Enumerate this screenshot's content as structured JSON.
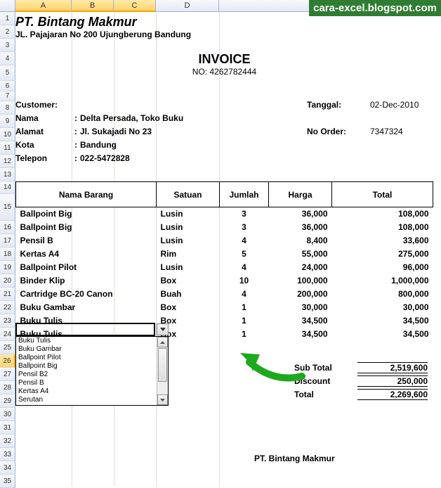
{
  "watermark": "cara-excel.blogspot.com",
  "columns": [
    "A",
    "B",
    "C",
    "D"
  ],
  "row_count": 35,
  "company": {
    "name": "PT. Bintang Makmur",
    "address": "JL. Pajajaran No 200 Ujungberung Bandung"
  },
  "invoice": {
    "title": "INVOICE",
    "number_label": "NO:",
    "number": "4262782444"
  },
  "customer": {
    "header": "Customer:",
    "rows": [
      {
        "label": "Nama",
        "value": "Delta Persada, Toko Buku"
      },
      {
        "label": "Alamat",
        "value": "Jl. Sukajadi No 23"
      },
      {
        "label": "Kota",
        "value": "Bandung"
      },
      {
        "label": "Telepon",
        "value": "022-5472828"
      }
    ],
    "date_label": "Tanggal:",
    "date": "02-Dec-2010",
    "order_label": "No Order:",
    "order": "7347324"
  },
  "table": {
    "headers": [
      "Nama Barang",
      "Satuan",
      "Jumlah",
      "Harga",
      "Total"
    ],
    "rows": [
      {
        "name": "Ballpoint Big",
        "unit": "Lusin",
        "qty": "3",
        "price": "36,000",
        "total": "108,000"
      },
      {
        "name": "Ballpoint Big",
        "unit": "Lusin",
        "qty": "3",
        "price": "36,000",
        "total": "108,000"
      },
      {
        "name": "Pensil B",
        "unit": "Lusin",
        "qty": "4",
        "price": "8,400",
        "total": "33,600"
      },
      {
        "name": "Kertas A4",
        "unit": "Rim",
        "qty": "5",
        "price": "55,000",
        "total": "275,000"
      },
      {
        "name": "Ballpoint Pilot",
        "unit": "Lusin",
        "qty": "4",
        "price": "24,000",
        "total": "96,000"
      },
      {
        "name": "Binder Klip",
        "unit": "Box",
        "qty": "10",
        "price": "100,000",
        "total": "1,000,000"
      },
      {
        "name": "Cartridge BC-20 Canon",
        "unit": "Buah",
        "qty": "4",
        "price": "200,000",
        "total": "800,000"
      },
      {
        "name": "Buku Gambar",
        "unit": "Box",
        "qty": "1",
        "price": "30,000",
        "total": "30,000"
      },
      {
        "name": "Buku Tulis",
        "unit": "Box",
        "qty": "1",
        "price": "34,500",
        "total": "34,500"
      },
      {
        "name": "Buku Tulis",
        "unit": "Box",
        "qty": "1",
        "price": "34,500",
        "total": "34,500"
      }
    ]
  },
  "dropdown": {
    "items": [
      "Buku Tulis",
      "Buku Gambar",
      "Ballpoint Pilot",
      "Ballpoint Big",
      "Pensil B2",
      "Pensil B",
      "Kertas A4",
      "Serutan"
    ]
  },
  "totals": {
    "subtotal_label": "Sub Total",
    "subtotal": "2,519,600",
    "discount_label": "Discount",
    "discount": "250,000",
    "total_label": "Total",
    "total": "2,269,600"
  },
  "footer_company": "PT. Bintang Makmur",
  "active_row": 26,
  "chart_data": {
    "type": "table",
    "title": "INVOICE NO: 4262782444",
    "columns": [
      "Nama Barang",
      "Satuan",
      "Jumlah",
      "Harga",
      "Total"
    ],
    "rows": [
      [
        "Ballpoint Big",
        "Lusin",
        3,
        36000,
        108000
      ],
      [
        "Ballpoint Big",
        "Lusin",
        3,
        36000,
        108000
      ],
      [
        "Pensil B",
        "Lusin",
        4,
        8400,
        33600
      ],
      [
        "Kertas A4",
        "Rim",
        5,
        55000,
        275000
      ],
      [
        "Ballpoint Pilot",
        "Lusin",
        4,
        24000,
        96000
      ],
      [
        "Binder Klip",
        "Box",
        10,
        100000,
        1000000
      ],
      [
        "Cartridge BC-20 Canon",
        "Buah",
        4,
        200000,
        800000
      ],
      [
        "Buku Gambar",
        "Box",
        1,
        30000,
        30000
      ],
      [
        "Buku Tulis",
        "Box",
        1,
        34500,
        34500
      ],
      [
        "Buku Tulis",
        "Box",
        1,
        34500,
        34500
      ]
    ],
    "subtotal": 2519600,
    "discount": 250000,
    "total": 2269600
  }
}
